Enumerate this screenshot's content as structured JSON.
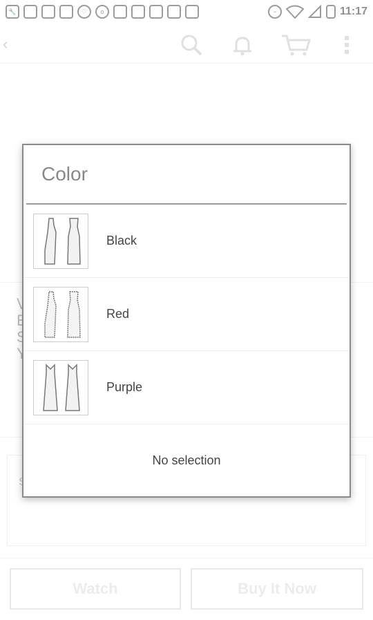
{
  "status_bar": {
    "time": "11:17",
    "icons": [
      "wrench-icon",
      "sim-icon",
      "chat-icon",
      "sim-icon",
      "heart-icon",
      "o-icon",
      "no-sync-icon",
      "android-icon",
      "android-icon",
      "mail-icon",
      "bag-icon",
      "minus-circle-icon",
      "wifi-icon",
      "no-signal-icon",
      "battery-icon"
    ]
  },
  "app_bar": {
    "icons": [
      "back-icon",
      "search-icon",
      "bell-icon",
      "cart-icon",
      "overflow-menu-icon"
    ]
  },
  "background": {
    "box_text": "S",
    "buttons": {
      "watch": "Watch",
      "buy_now": "Buy It Now"
    }
  },
  "dialog": {
    "title": "Color",
    "options": [
      {
        "label": "Black"
      },
      {
        "label": "Red"
      },
      {
        "label": "Purple"
      }
    ],
    "no_selection": "No selection"
  }
}
